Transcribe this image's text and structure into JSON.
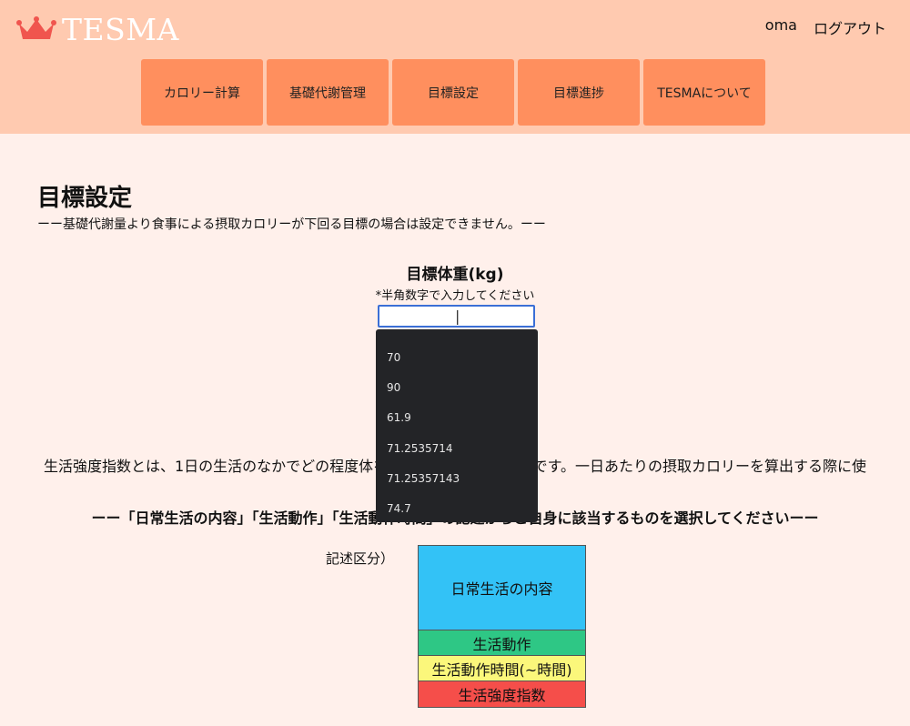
{
  "header": {
    "logo_text": "TESMA",
    "user_name": "oma",
    "logout_label": "ログアウト"
  },
  "nav": {
    "items": [
      "カロリー計算",
      "基礎代謝管理",
      "目標設定",
      "目標進捗",
      "TESMAについて"
    ]
  },
  "page": {
    "title": "目標設定",
    "notice": "ーー基礎代謝量より食事による摂取カロリーが下回る目標の場合は設定できません。ーー"
  },
  "weight": {
    "label": "目標体重(kg)",
    "hint": "*半角数字で入力してください",
    "value": "",
    "autocomplete_options": [
      "70",
      "90",
      "61.9",
      "71.2535714",
      "71.25357143",
      "74.7"
    ]
  },
  "description": {
    "paragraph": "生活強度指数とは、1日の生活のなかでどの程度体を動かしているかの数値です。一日あたりの摂取カロリーを算出する際に使用します。",
    "instruction": "ーー「日常生活の内容」「生活動作」「生活動作時間」の記述からご自身に該当するものを選択してくださいーー"
  },
  "legend": {
    "label": "記述区分）",
    "items": [
      "日常生活の内容",
      "生活動作",
      "生活動作時間(~時間)",
      "生活強度指数"
    ],
    "colors": [
      "#33c2f6",
      "#2ec785",
      "#fbf77b",
      "#f54e4a"
    ]
  },
  "colors": {
    "header_bg": "#ffcab0",
    "nav_button": "#ff8f5e",
    "page_bg": "#fff0eb",
    "dropdown_bg": "#232427"
  }
}
